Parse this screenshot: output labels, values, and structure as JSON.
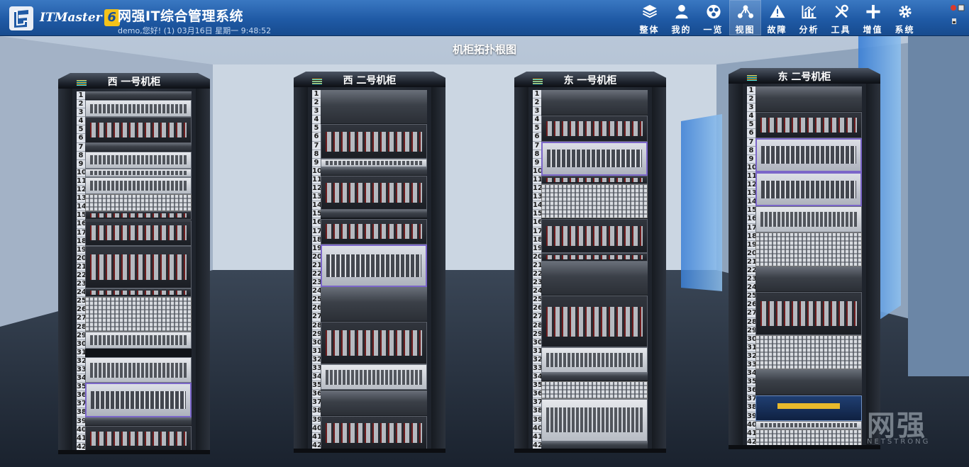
{
  "app": {
    "brand": "ITMaster",
    "brand_version": "6",
    "title": "网强IT综合管理系统",
    "status_line": "demo,您好! (1) 03月16日 星期一 9:48:52"
  },
  "nav": [
    {
      "label": "整体",
      "icon": "layers-icon"
    },
    {
      "label": "我的",
      "icon": "user-icon"
    },
    {
      "label": "一览",
      "icon": "overview-icon"
    },
    {
      "label": "视图",
      "icon": "topology-icon",
      "active": true
    },
    {
      "label": "故障",
      "icon": "warning-icon"
    },
    {
      "label": "分析",
      "icon": "chart-icon"
    },
    {
      "label": "工具",
      "icon": "tools-icon"
    },
    {
      "label": "增值",
      "icon": "plus-icon"
    },
    {
      "label": "系统",
      "icon": "gear-icon"
    }
  ],
  "page": {
    "title": "机柜拓扑根图"
  },
  "racks": [
    {
      "name": "西 一号机柜",
      "units": 42,
      "devices": [
        {
          "start": 1,
          "size": 1,
          "style": "blank"
        },
        {
          "start": 2,
          "size": 2,
          "style": "silver"
        },
        {
          "start": 4,
          "size": 3,
          "style": "dark"
        },
        {
          "start": 7,
          "size": 1,
          "style": "blank"
        },
        {
          "start": 8,
          "size": 2,
          "style": "silver"
        },
        {
          "start": 10,
          "size": 1,
          "style": "silver"
        },
        {
          "start": 11,
          "size": 2,
          "style": "silver"
        },
        {
          "start": 13,
          "size": 2,
          "style": "mesh"
        },
        {
          "start": 15,
          "size": 1,
          "style": "dark"
        },
        {
          "start": 16,
          "size": 3,
          "style": "dark"
        },
        {
          "start": 19,
          "size": 5,
          "style": "dark"
        },
        {
          "start": 24,
          "size": 1,
          "style": "dark"
        },
        {
          "start": 25,
          "size": 4,
          "style": "mesh"
        },
        {
          "start": 29,
          "size": 2,
          "style": "silver"
        },
        {
          "start": 32,
          "size": 3,
          "style": "silver"
        },
        {
          "start": 35,
          "size": 4,
          "style": "purple"
        },
        {
          "start": 39,
          "size": 1,
          "style": "blank"
        },
        {
          "start": 40,
          "size": 3,
          "style": "dark"
        }
      ]
    },
    {
      "name": "西 二号机柜",
      "units": 42,
      "devices": [
        {
          "start": 1,
          "size": 4,
          "style": "blank"
        },
        {
          "start": 5,
          "size": 4,
          "style": "dark"
        },
        {
          "start": 9,
          "size": 1,
          "style": "silver"
        },
        {
          "start": 10,
          "size": 1,
          "style": "blank"
        },
        {
          "start": 11,
          "size": 4,
          "style": "dark"
        },
        {
          "start": 15,
          "size": 1,
          "style": "blank"
        },
        {
          "start": 16,
          "size": 3,
          "style": "dark"
        },
        {
          "start": 19,
          "size": 5,
          "style": "purple"
        },
        {
          "start": 24,
          "size": 4,
          "style": "blank"
        },
        {
          "start": 28,
          "size": 5,
          "style": "dark"
        },
        {
          "start": 33,
          "size": 3,
          "style": "silver"
        },
        {
          "start": 36,
          "size": 3,
          "style": "blank"
        },
        {
          "start": 39,
          "size": 4,
          "style": "dark"
        }
      ]
    },
    {
      "name": "东 一号机柜",
      "units": 42,
      "devices": [
        {
          "start": 1,
          "size": 3,
          "style": "blank"
        },
        {
          "start": 4,
          "size": 3,
          "style": "dark"
        },
        {
          "start": 7,
          "size": 4,
          "style": "purple"
        },
        {
          "start": 11,
          "size": 1,
          "style": "dark"
        },
        {
          "start": 12,
          "size": 4,
          "style": "mesh"
        },
        {
          "start": 16,
          "size": 4,
          "style": "dark"
        },
        {
          "start": 20,
          "size": 1,
          "style": "dark"
        },
        {
          "start": 21,
          "size": 4,
          "style": "blank"
        },
        {
          "start": 25,
          "size": 6,
          "style": "dark"
        },
        {
          "start": 31,
          "size": 3,
          "style": "silver"
        },
        {
          "start": 34,
          "size": 1,
          "style": "blank"
        },
        {
          "start": 35,
          "size": 2,
          "style": "mesh"
        },
        {
          "start": 37,
          "size": 5,
          "style": "silver"
        },
        {
          "start": 42,
          "size": 1,
          "style": "blank"
        }
      ]
    },
    {
      "name": "东 二号机柜",
      "units": 42,
      "devices": [
        {
          "start": 1,
          "size": 3,
          "style": "blank"
        },
        {
          "start": 4,
          "size": 3,
          "style": "dark"
        },
        {
          "start": 7,
          "size": 4,
          "style": "purple"
        },
        {
          "start": 11,
          "size": 4,
          "style": "purple"
        },
        {
          "start": 15,
          "size": 3,
          "style": "silver"
        },
        {
          "start": 18,
          "size": 4,
          "style": "mesh"
        },
        {
          "start": 22,
          "size": 3,
          "style": "blank"
        },
        {
          "start": 25,
          "size": 5,
          "style": "dark"
        },
        {
          "start": 30,
          "size": 4,
          "style": "mesh"
        },
        {
          "start": 34,
          "size": 3,
          "style": "blank"
        },
        {
          "start": 37,
          "size": 3,
          "style": "navy"
        },
        {
          "start": 40,
          "size": 1,
          "style": "silver"
        },
        {
          "start": 41,
          "size": 2,
          "style": "mesh"
        }
      ]
    }
  ],
  "watermark": {
    "text": "网强",
    "sub": "NETSTRONG"
  }
}
